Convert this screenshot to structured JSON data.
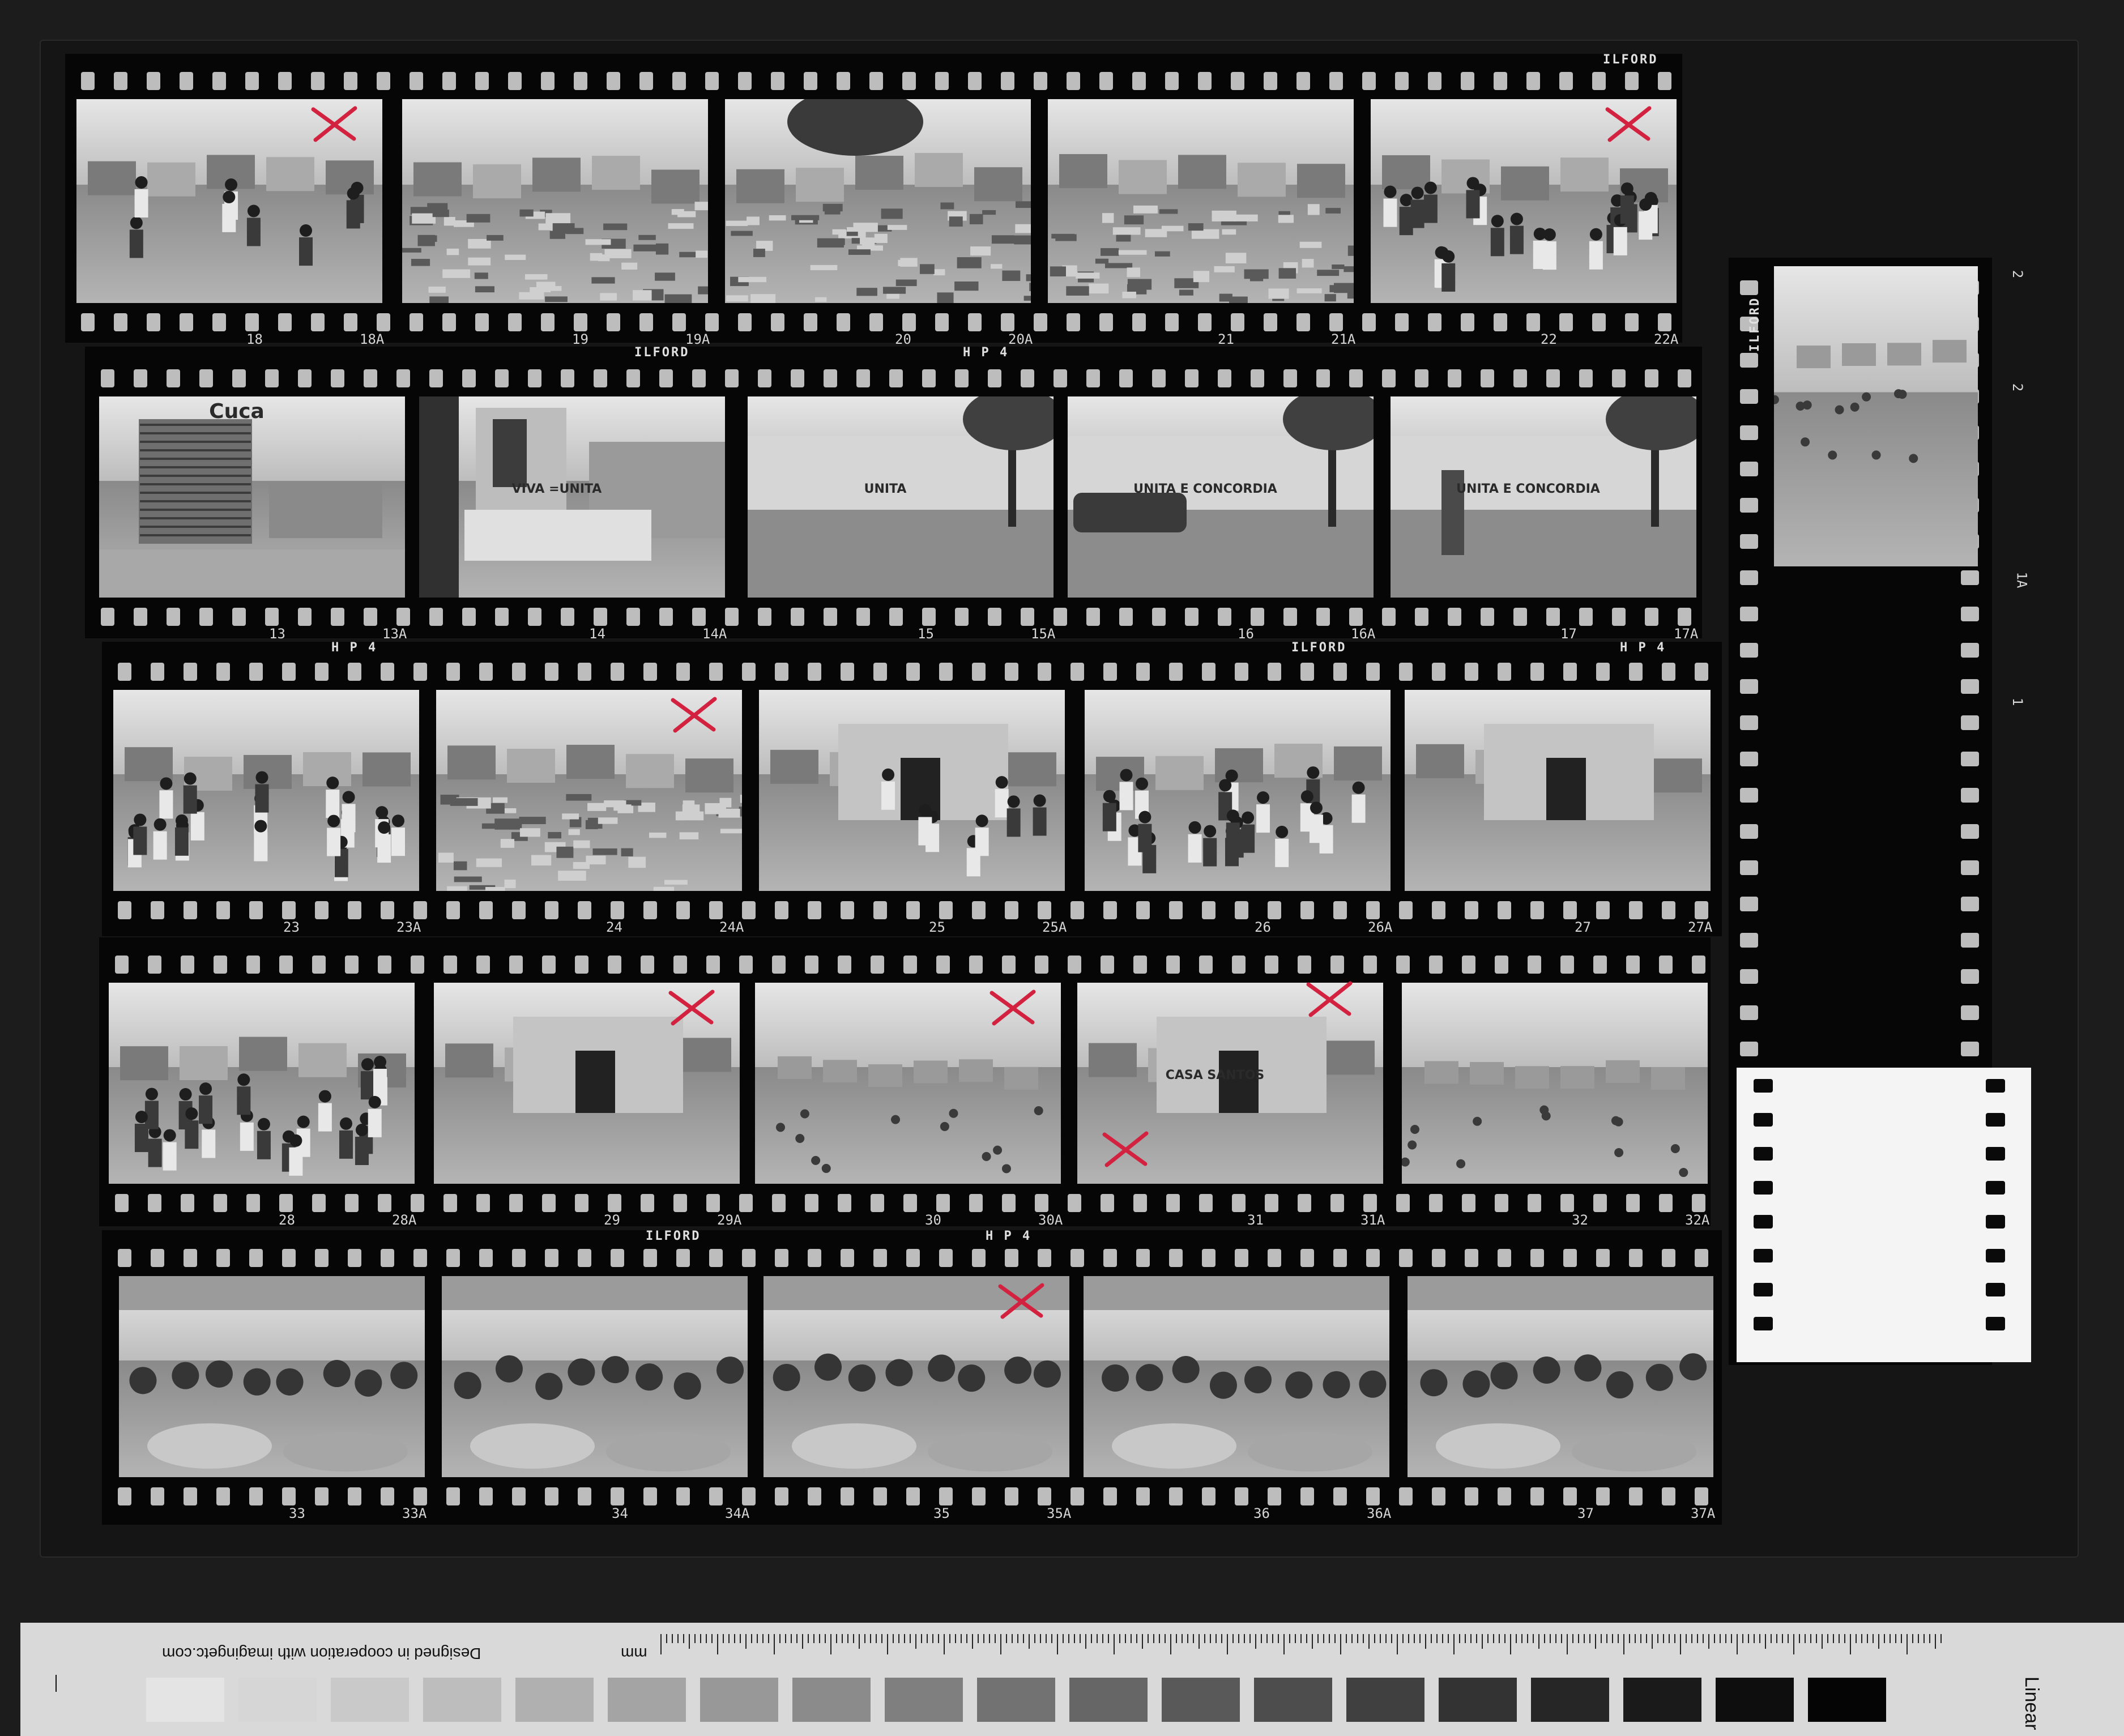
{
  "contact_sheet": {
    "strips": [
      {
        "id": "strip-1",
        "brand_labels": [
          "ILFORD"
        ],
        "frames": [
          {
            "num": "18",
            "alt": "18A",
            "marked": true,
            "scene": "shacks"
          },
          {
            "num": "19",
            "alt": "19A",
            "marked": false,
            "scene": "rubble"
          },
          {
            "num": "20",
            "alt": "20A",
            "marked": false,
            "scene": "rubble-tree"
          },
          {
            "num": "21",
            "alt": "21A",
            "marked": false,
            "scene": "rubble"
          },
          {
            "num": "22",
            "alt": "22A",
            "marked": true,
            "scene": "crowd"
          }
        ]
      },
      {
        "id": "strip-2",
        "brand_labels": [
          "ILFORD",
          "H P 4"
        ],
        "frames": [
          {
            "num": "13",
            "alt": "13A",
            "marked": false,
            "scene": "tower",
            "sign": "Cuca"
          },
          {
            "num": "14",
            "alt": "14A",
            "marked": false,
            "scene": "statue",
            "sign": "VIVA =UNITA"
          },
          {
            "num": "15",
            "alt": "15A",
            "marked": false,
            "scene": "wall",
            "sign": "UNITA"
          },
          {
            "num": "16",
            "alt": "16A",
            "marked": false,
            "scene": "wall-car",
            "sign": "UNITA E CONCORDIA"
          },
          {
            "num": "17",
            "alt": "17A",
            "marked": false,
            "scene": "wall-man",
            "sign": "UNITA E CONCORDIA"
          }
        ]
      },
      {
        "id": "strip-3",
        "brand_labels": [
          "H P 4",
          "ILFORD",
          "H P 4"
        ],
        "frames": [
          {
            "num": "23",
            "alt": "23A",
            "marked": false,
            "scene": "crowd"
          },
          {
            "num": "24",
            "alt": "24A",
            "marked": true,
            "scene": "rubble"
          },
          {
            "num": "25",
            "alt": "25A",
            "marked": false,
            "scene": "house-crowd"
          },
          {
            "num": "26",
            "alt": "26A",
            "marked": false,
            "scene": "crowd"
          },
          {
            "num": "27",
            "alt": "27A",
            "marked": false,
            "scene": "house"
          }
        ]
      },
      {
        "id": "strip-4",
        "brand_labels": [],
        "frames": [
          {
            "num": "28",
            "alt": "28A",
            "marked": false,
            "scene": "crowd"
          },
          {
            "num": "29",
            "alt": "29A",
            "marked": true,
            "scene": "storefront"
          },
          {
            "num": "30",
            "alt": "30A",
            "marked": true,
            "scene": "field"
          },
          {
            "num": "31",
            "alt": "31A",
            "marked": true,
            "scene": "house",
            "sign": "CASA SANTOS"
          },
          {
            "num": "32",
            "alt": "32A",
            "marked": false,
            "scene": "field"
          }
        ]
      },
      {
        "id": "strip-5",
        "brand_labels": [
          "ILFORD",
          "H P 4"
        ],
        "frames": [
          {
            "num": "33",
            "alt": "33A",
            "marked": false,
            "scene": "market"
          },
          {
            "num": "34",
            "alt": "34A",
            "marked": false,
            "scene": "market"
          },
          {
            "num": "35",
            "alt": "35A",
            "marked": true,
            "scene": "market"
          },
          {
            "num": "36",
            "alt": "36A",
            "marked": false,
            "scene": "market"
          },
          {
            "num": "37",
            "alt": "37A",
            "marked": false,
            "scene": "market"
          }
        ]
      }
    ],
    "side_strip": {
      "brand": "ILFORD",
      "edge_numbers": [
        "2",
        "2",
        "1A",
        "1"
      ],
      "scene": "street-aerial"
    }
  },
  "color_target": {
    "credit": "Designed in cooperation with imagingetc.com",
    "unit": "mm",
    "label": "Linear",
    "patch_grays": [
      "#e4e4e4",
      "#d6d6d6",
      "#c9c9c9",
      "#bdbdbd",
      "#b0b0b0",
      "#a4a4a4",
      "#989898",
      "#8b8b8b",
      "#7f7f7f",
      "#727272",
      "#666666",
      "#595959",
      "#4d4d4d",
      "#404040",
      "#333333",
      "#262626",
      "#1a1a1a",
      "#0e0e0e",
      "#050505"
    ]
  },
  "colors": {
    "mark_red": "#d2223f",
    "film_black": "#060606"
  }
}
